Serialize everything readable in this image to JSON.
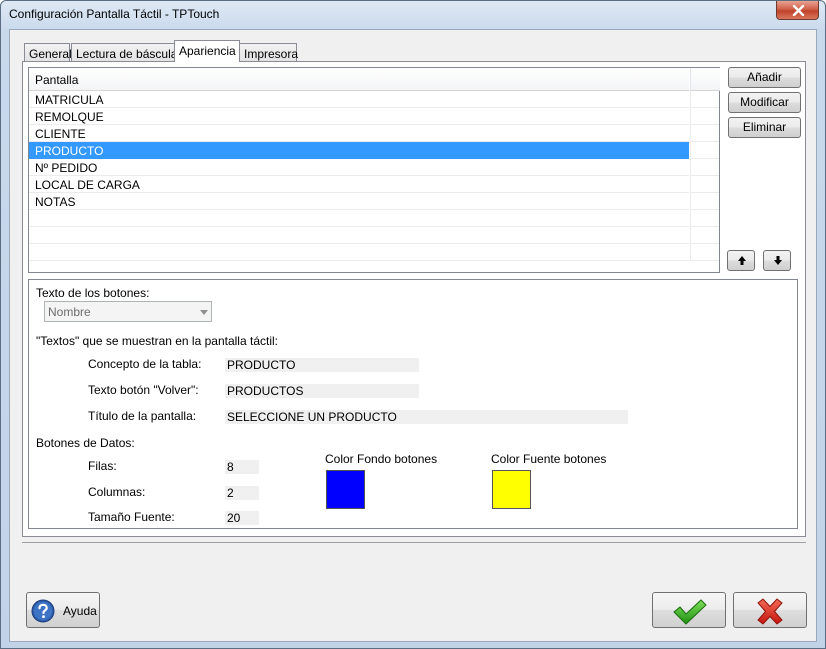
{
  "window": {
    "title": "Configuración Pantalla Táctil - TPTouch"
  },
  "tabs": [
    {
      "label": "General"
    },
    {
      "label": "Lectura de báscula"
    },
    {
      "label": "Apariencia"
    },
    {
      "label": "Impresora"
    }
  ],
  "screens_list": {
    "header": "Pantalla",
    "items": [
      "MATRICULA",
      "REMOLQUE",
      "CLIENTE",
      "PRODUCTO",
      "Nº PEDIDO",
      "LOCAL DE CARGA",
      "NOTAS"
    ],
    "selected_index": 3
  },
  "list_buttons": {
    "add": "Añadir",
    "modify": "Modificar",
    "delete": "Eliminar"
  },
  "button_text": {
    "label": "Texto de los botones:",
    "selected_value": "Nombre"
  },
  "texts_section": {
    "label": "\"Textos\" que se muestran en la pantalla táctil:",
    "table_concept_label": "Concepto de la tabla:",
    "table_concept_value": "PRODUCTO",
    "back_button_label": "Texto botón \"Volver\":",
    "back_button_value": "PRODUCTOS",
    "screen_title_label": "Título de la pantalla:",
    "screen_title_value": "SELECCIONE UN PRODUCTO"
  },
  "data_buttons": {
    "label": "Botones de Datos:",
    "rows_label": "Filas:",
    "rows_value": "8",
    "columns_label": "Columnas:",
    "columns_value": "2",
    "font_size_label": "Tamaño Fuente:",
    "font_size_value": "20",
    "bg_color_label": "Color Fondo botones",
    "bg_color": "#0000ff",
    "font_color_label": "Color Fuente botones",
    "font_color": "#ffff00"
  },
  "footer": {
    "help_label": "Ayuda"
  },
  "icons": {
    "close": "close-icon",
    "help": "help-icon",
    "ok": "checkmark-icon",
    "cancel": "cross-icon",
    "move_up": "arrow-up-icon",
    "move_down": "arrow-down-icon"
  }
}
